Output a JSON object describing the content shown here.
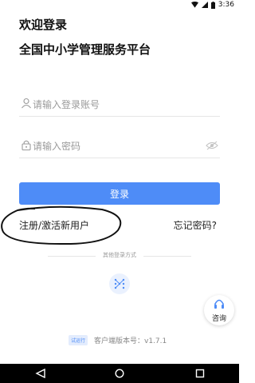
{
  "status_bar": {
    "time": "3:36"
  },
  "header": {
    "title_line1": "欢迎登录",
    "title_line2": "全国中小学管理服务平台"
  },
  "form": {
    "account_placeholder": "请输入登录账号",
    "password_placeholder": "请输入密码",
    "login_label": "登录"
  },
  "links": {
    "register": "注册/激活新用户",
    "forgot": "忘记密码?"
  },
  "other_login": {
    "label": "其他登录方式"
  },
  "consult": {
    "label": "咨询"
  },
  "footer": {
    "badge": "试运行",
    "version": "客户端版本号：v1.7.1"
  },
  "colors": {
    "accent": "#4e8cf7"
  }
}
